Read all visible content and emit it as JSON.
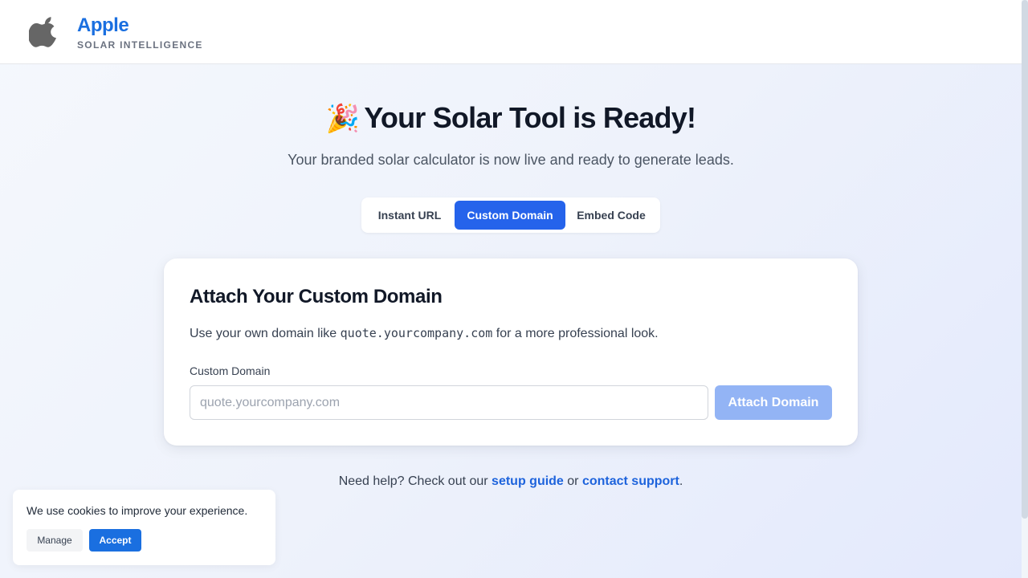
{
  "header": {
    "brand_name": "Apple",
    "brand_subtitle": "SOLAR INTELLIGENCE",
    "logo_icon": "apple-logo-icon"
  },
  "hero": {
    "emoji": "🎉",
    "title": "Your Solar Tool is Ready!",
    "subtitle": "Your branded solar calculator is now live and ready to generate leads."
  },
  "tabs": [
    {
      "label": "Instant URL",
      "active": false
    },
    {
      "label": "Custom Domain",
      "active": true
    },
    {
      "label": "Embed Code",
      "active": false
    }
  ],
  "card": {
    "title": "Attach Your Custom Domain",
    "desc_before": "Use your own domain like ",
    "desc_code": "quote.yourcompany.com",
    "desc_after": " for a more professional look.",
    "field_label": "Custom Domain",
    "input_value": "",
    "input_placeholder": "quote.yourcompany.com",
    "button_label": "Attach Domain"
  },
  "help": {
    "prefix": "Need help? Check out our ",
    "link1": "setup guide",
    "middle": " or ",
    "link2": "contact support",
    "suffix": "."
  },
  "cookie": {
    "message": "We use cookies to improve your experience.",
    "manage_label": "Manage",
    "accept_label": "Accept"
  },
  "colors": {
    "brand": "#1a6fe0",
    "primary": "#2563eb",
    "primary_disabled": "#93b4f5"
  }
}
